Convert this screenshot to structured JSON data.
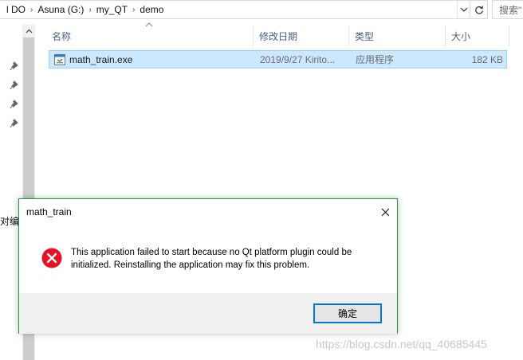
{
  "address_bar": {
    "crumbs": [
      "l DO",
      "Asuna (G:)",
      "my_QT",
      "demo"
    ],
    "separator": "›"
  },
  "search": {
    "placeholder": "搜索\""
  },
  "navigation": {
    "partial_label": "对编"
  },
  "file_list": {
    "columns": {
      "name": "名称",
      "modified": "修改日期",
      "type": "类型",
      "size": "大小"
    },
    "rows": [
      {
        "name": "math_train.exe",
        "modified": "2019/9/27 Kirito...",
        "type": "应用程序",
        "size": "182 KB",
        "icon": "exe-file-icon",
        "selected": true
      }
    ]
  },
  "dialog": {
    "title": "math_train",
    "message": "This application failed to start because no Qt platform plugin could be initialized. Reinstalling the application may fix this problem.",
    "ok_label": "确定",
    "icon": "error-icon"
  },
  "watermark": "https://blog.csdn.net/qq_40685445",
  "colors": {
    "selection_bg": "#cce8ff",
    "selection_border": "#99d1ff",
    "header_text": "#4c607a",
    "error_red": "#e81123",
    "dialog_border": "#1f9a47",
    "button_focus": "#0078d7"
  }
}
